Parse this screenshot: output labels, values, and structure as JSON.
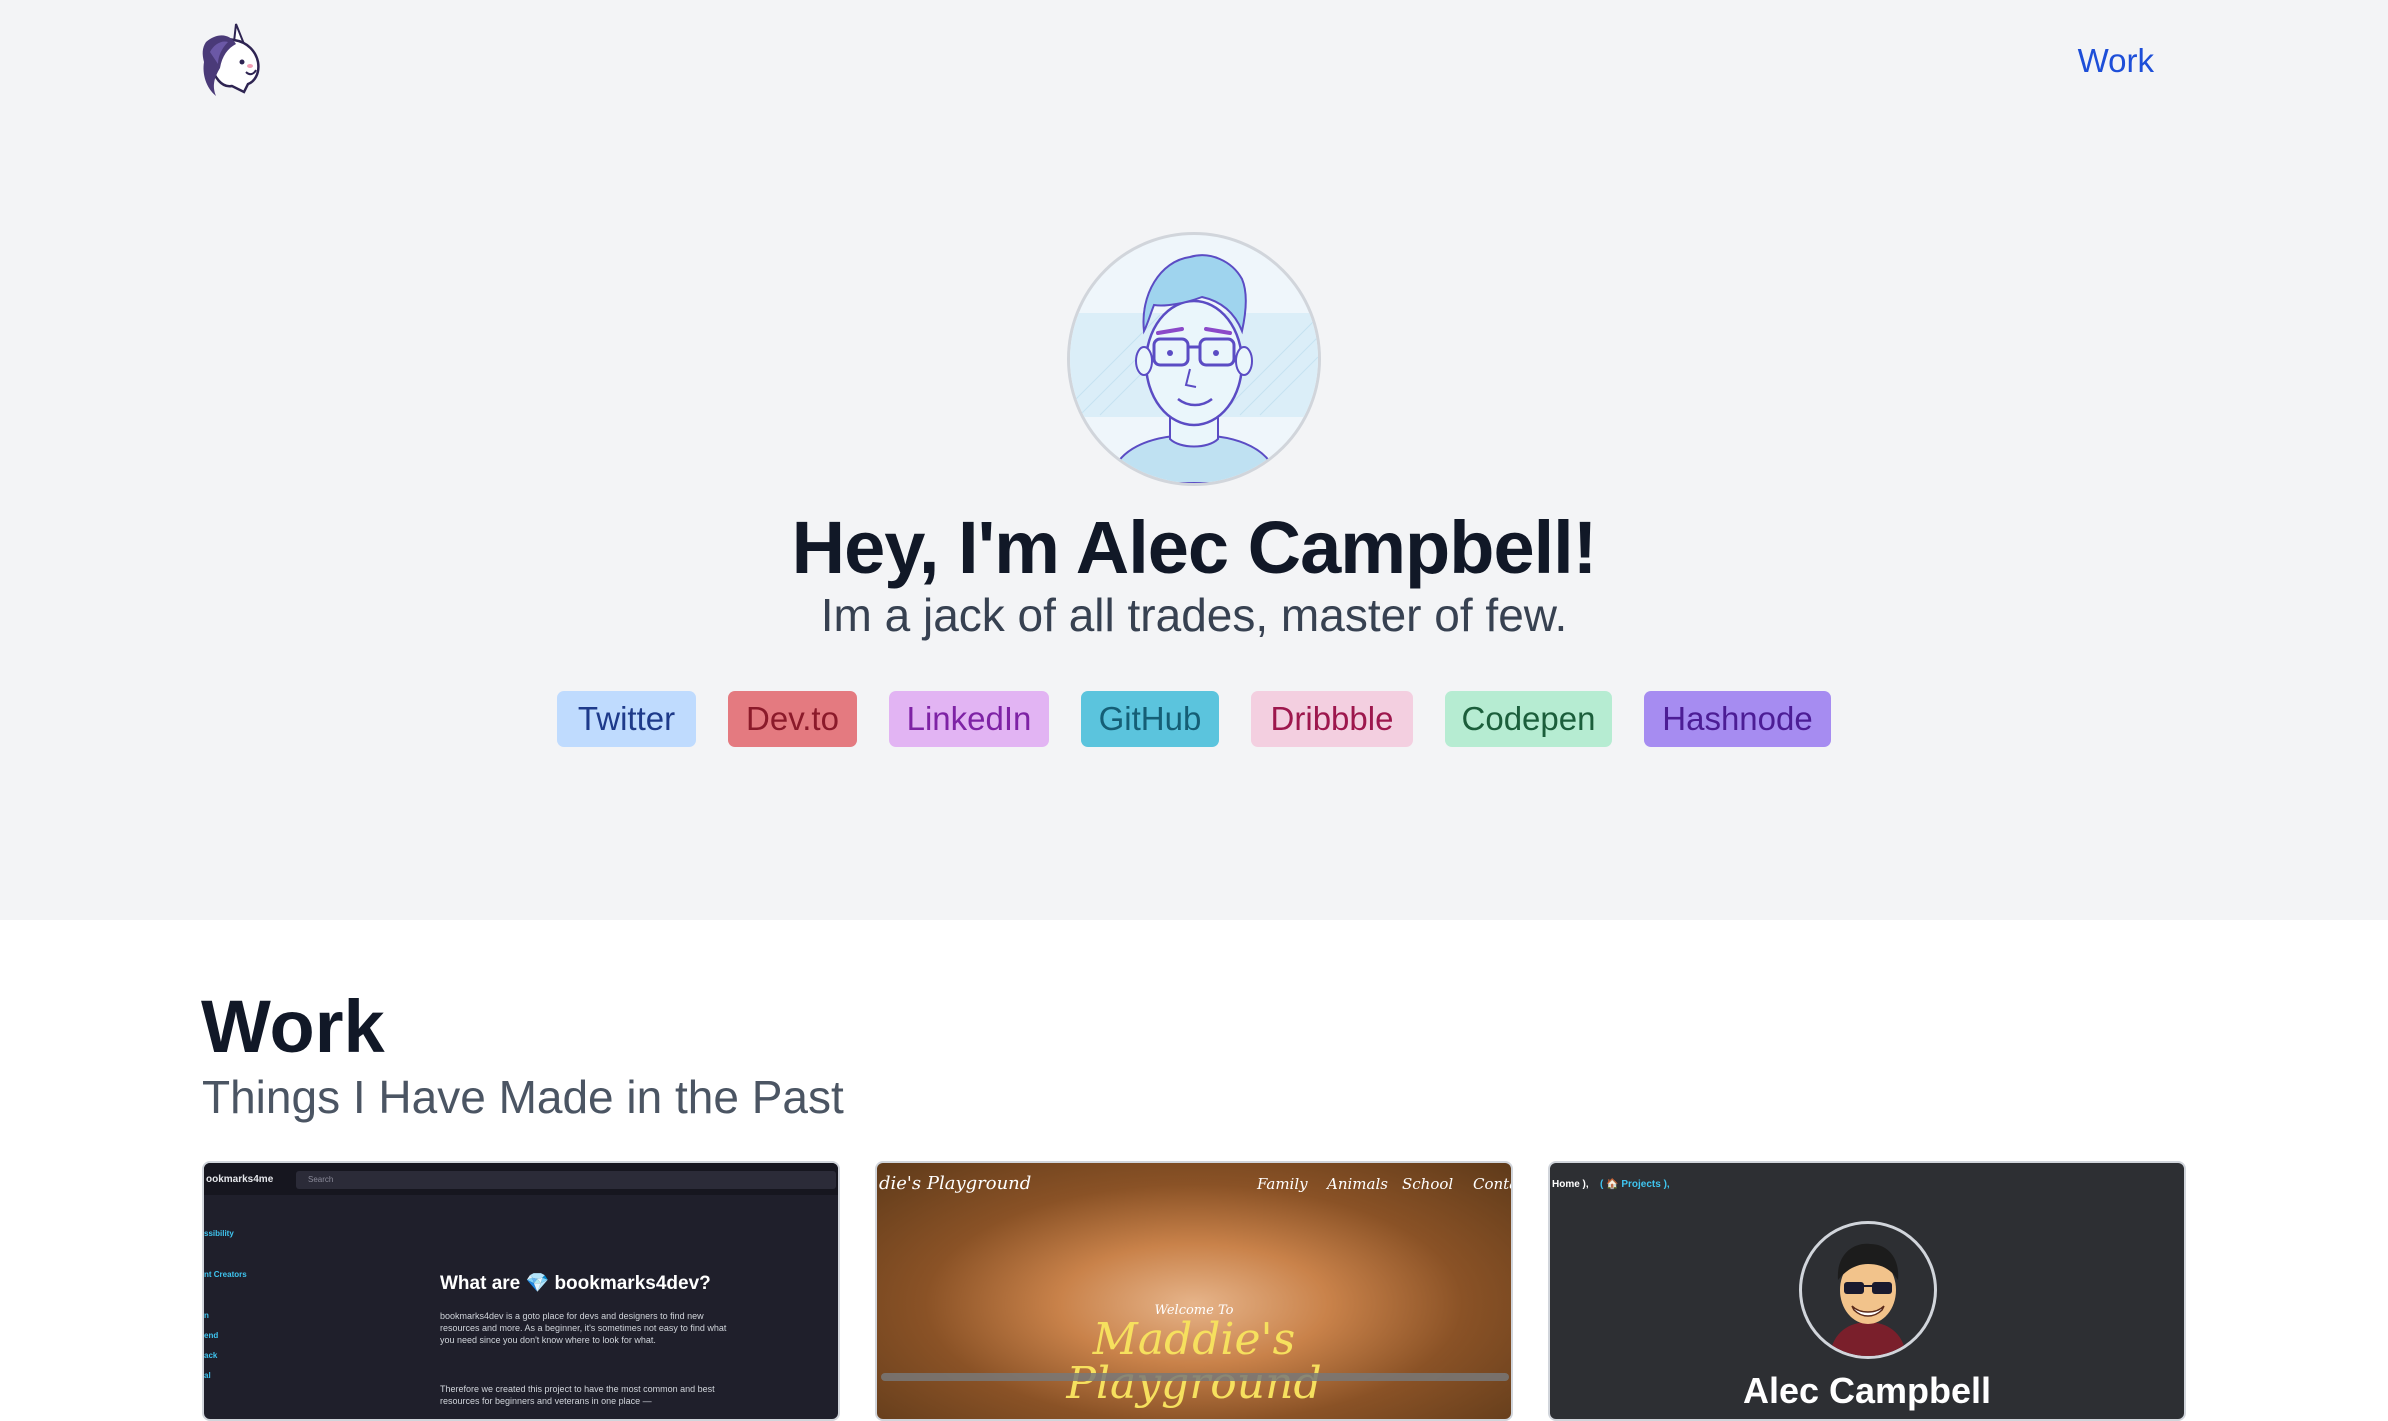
{
  "header": {
    "nav_work": "Work"
  },
  "hero": {
    "title": "Hey, I'm Alec Campbell!",
    "subtitle": "Im a jack of all trades, master of few."
  },
  "social": [
    {
      "label": "Twitter",
      "bg": "#bfdbfe",
      "color": "#1e3a8a"
    },
    {
      "label": "Dev.to",
      "bg": "#e47a80",
      "color": "#8b1a2a"
    },
    {
      "label": "LinkedIn",
      "bg": "#e2b4f3",
      "color": "#7e22a5"
    },
    {
      "label": "GitHub",
      "bg": "#5bc4dd",
      "color": "#155e75"
    },
    {
      "label": "Dribbble",
      "bg": "#f3cfe0",
      "color": "#9d174d"
    },
    {
      "label": "Codepen",
      "bg": "#b6ecd2",
      "color": "#1b5e3b"
    },
    {
      "label": "Hashnode",
      "bg": "#a68cf1",
      "color": "#4c1d95"
    }
  ],
  "work": {
    "title": "Work",
    "subtitle": "Things I Have Made in the Past"
  },
  "cards": {
    "c1": {
      "brand": "ookmarks4me",
      "search": "Search",
      "side": [
        "ssibility",
        "nt Creators",
        "n",
        "end",
        "ack",
        "al"
      ],
      "heading": "What are 💎 bookmarks4dev?",
      "para1": "bookmarks4dev is a goto place for devs and designers to find new resources and more. As a beginner, it's sometimes not easy to find what you need since you don't know where to look for what.",
      "para2": "Therefore we created this project to have the most common and best resources for beginners and veterans in one place —"
    },
    "c2": {
      "title": "die's Playground",
      "nav": [
        "Family",
        "Animals",
        "School",
        "Conta"
      ],
      "welcome": "Welcome To",
      "big1": "Maddie's",
      "big2": "Playground"
    },
    "c3": {
      "crumb": "Home ),",
      "crumb2": "( 🏠 Projects ),",
      "name": "Alec Campbell"
    }
  }
}
